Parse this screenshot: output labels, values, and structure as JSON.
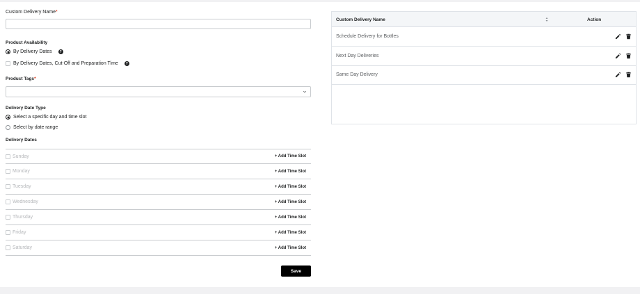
{
  "form": {
    "name_label": "Custom Delivery Name",
    "required_mark": "*",
    "name_value": "",
    "availability_label": "Product Availability",
    "availability_options": [
      {
        "label": "By Delivery Dates",
        "selected": true
      },
      {
        "label": "By Delivery Dates, Cut-Off and Preparation Time",
        "selected": false
      }
    ],
    "help_glyph": "?",
    "tags_label": "Product Tags",
    "tags_value": "",
    "date_type_label": "Delivery Date Type",
    "date_type_options": [
      {
        "label": "Select a specific day and time slot",
        "selected": true
      },
      {
        "label": "Select by date range",
        "selected": false
      }
    ],
    "delivery_dates_label": "Delivery Dates",
    "days": [
      {
        "label": "Sunday",
        "add_label": "+ Add Time Slot"
      },
      {
        "label": "Monday",
        "add_label": "+ Add Time Slot"
      },
      {
        "label": "Tuesday",
        "add_label": "+ Add Time Slot"
      },
      {
        "label": "Wednesday",
        "add_label": "+ Add Time Slot"
      },
      {
        "label": "Thursday",
        "add_label": "+ Add Time Slot"
      },
      {
        "label": "Friday",
        "add_label": "+ Add Time Slot"
      },
      {
        "label": "Saturday",
        "add_label": "+ Add Time Slot"
      }
    ],
    "save_label": "Save"
  },
  "table": {
    "col_name": "Custom Delivery Name",
    "col_action": "Action",
    "rows": [
      {
        "name": "Schedule Delivery for Bottles"
      },
      {
        "name": "Next Day Deliveries"
      },
      {
        "name": "Same Day Delivery"
      }
    ]
  },
  "colors": {
    "required": "#d82c0d",
    "button_bg": "#000000",
    "header_bg": "#f4f6f8"
  },
  "icons": [
    "help-icon",
    "chevron-down-icon",
    "sort-icon",
    "edit-icon",
    "delete-icon"
  ]
}
